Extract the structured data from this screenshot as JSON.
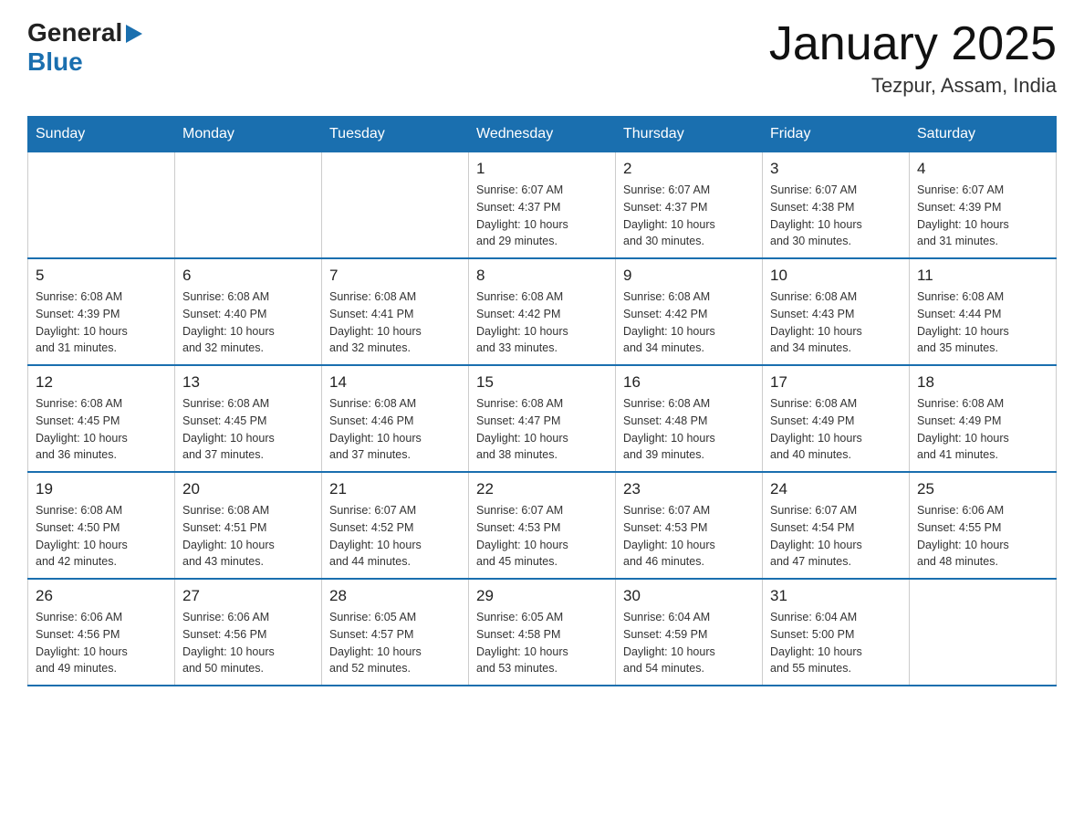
{
  "header": {
    "logo_general": "General",
    "logo_blue": "Blue",
    "title": "January 2025",
    "subtitle": "Tezpur, Assam, India"
  },
  "weekdays": [
    "Sunday",
    "Monday",
    "Tuesday",
    "Wednesday",
    "Thursday",
    "Friday",
    "Saturday"
  ],
  "weeks": [
    [
      {
        "day": "",
        "info": ""
      },
      {
        "day": "",
        "info": ""
      },
      {
        "day": "",
        "info": ""
      },
      {
        "day": "1",
        "info": "Sunrise: 6:07 AM\nSunset: 4:37 PM\nDaylight: 10 hours\nand 29 minutes."
      },
      {
        "day": "2",
        "info": "Sunrise: 6:07 AM\nSunset: 4:37 PM\nDaylight: 10 hours\nand 30 minutes."
      },
      {
        "day": "3",
        "info": "Sunrise: 6:07 AM\nSunset: 4:38 PM\nDaylight: 10 hours\nand 30 minutes."
      },
      {
        "day": "4",
        "info": "Sunrise: 6:07 AM\nSunset: 4:39 PM\nDaylight: 10 hours\nand 31 minutes."
      }
    ],
    [
      {
        "day": "5",
        "info": "Sunrise: 6:08 AM\nSunset: 4:39 PM\nDaylight: 10 hours\nand 31 minutes."
      },
      {
        "day": "6",
        "info": "Sunrise: 6:08 AM\nSunset: 4:40 PM\nDaylight: 10 hours\nand 32 minutes."
      },
      {
        "day": "7",
        "info": "Sunrise: 6:08 AM\nSunset: 4:41 PM\nDaylight: 10 hours\nand 32 minutes."
      },
      {
        "day": "8",
        "info": "Sunrise: 6:08 AM\nSunset: 4:42 PM\nDaylight: 10 hours\nand 33 minutes."
      },
      {
        "day": "9",
        "info": "Sunrise: 6:08 AM\nSunset: 4:42 PM\nDaylight: 10 hours\nand 34 minutes."
      },
      {
        "day": "10",
        "info": "Sunrise: 6:08 AM\nSunset: 4:43 PM\nDaylight: 10 hours\nand 34 minutes."
      },
      {
        "day": "11",
        "info": "Sunrise: 6:08 AM\nSunset: 4:44 PM\nDaylight: 10 hours\nand 35 minutes."
      }
    ],
    [
      {
        "day": "12",
        "info": "Sunrise: 6:08 AM\nSunset: 4:45 PM\nDaylight: 10 hours\nand 36 minutes."
      },
      {
        "day": "13",
        "info": "Sunrise: 6:08 AM\nSunset: 4:45 PM\nDaylight: 10 hours\nand 37 minutes."
      },
      {
        "day": "14",
        "info": "Sunrise: 6:08 AM\nSunset: 4:46 PM\nDaylight: 10 hours\nand 37 minutes."
      },
      {
        "day": "15",
        "info": "Sunrise: 6:08 AM\nSunset: 4:47 PM\nDaylight: 10 hours\nand 38 minutes."
      },
      {
        "day": "16",
        "info": "Sunrise: 6:08 AM\nSunset: 4:48 PM\nDaylight: 10 hours\nand 39 minutes."
      },
      {
        "day": "17",
        "info": "Sunrise: 6:08 AM\nSunset: 4:49 PM\nDaylight: 10 hours\nand 40 minutes."
      },
      {
        "day": "18",
        "info": "Sunrise: 6:08 AM\nSunset: 4:49 PM\nDaylight: 10 hours\nand 41 minutes."
      }
    ],
    [
      {
        "day": "19",
        "info": "Sunrise: 6:08 AM\nSunset: 4:50 PM\nDaylight: 10 hours\nand 42 minutes."
      },
      {
        "day": "20",
        "info": "Sunrise: 6:08 AM\nSunset: 4:51 PM\nDaylight: 10 hours\nand 43 minutes."
      },
      {
        "day": "21",
        "info": "Sunrise: 6:07 AM\nSunset: 4:52 PM\nDaylight: 10 hours\nand 44 minutes."
      },
      {
        "day": "22",
        "info": "Sunrise: 6:07 AM\nSunset: 4:53 PM\nDaylight: 10 hours\nand 45 minutes."
      },
      {
        "day": "23",
        "info": "Sunrise: 6:07 AM\nSunset: 4:53 PM\nDaylight: 10 hours\nand 46 minutes."
      },
      {
        "day": "24",
        "info": "Sunrise: 6:07 AM\nSunset: 4:54 PM\nDaylight: 10 hours\nand 47 minutes."
      },
      {
        "day": "25",
        "info": "Sunrise: 6:06 AM\nSunset: 4:55 PM\nDaylight: 10 hours\nand 48 minutes."
      }
    ],
    [
      {
        "day": "26",
        "info": "Sunrise: 6:06 AM\nSunset: 4:56 PM\nDaylight: 10 hours\nand 49 minutes."
      },
      {
        "day": "27",
        "info": "Sunrise: 6:06 AM\nSunset: 4:56 PM\nDaylight: 10 hours\nand 50 minutes."
      },
      {
        "day": "28",
        "info": "Sunrise: 6:05 AM\nSunset: 4:57 PM\nDaylight: 10 hours\nand 52 minutes."
      },
      {
        "day": "29",
        "info": "Sunrise: 6:05 AM\nSunset: 4:58 PM\nDaylight: 10 hours\nand 53 minutes."
      },
      {
        "day": "30",
        "info": "Sunrise: 6:04 AM\nSunset: 4:59 PM\nDaylight: 10 hours\nand 54 minutes."
      },
      {
        "day": "31",
        "info": "Sunrise: 6:04 AM\nSunset: 5:00 PM\nDaylight: 10 hours\nand 55 minutes."
      },
      {
        "day": "",
        "info": ""
      }
    ]
  ]
}
